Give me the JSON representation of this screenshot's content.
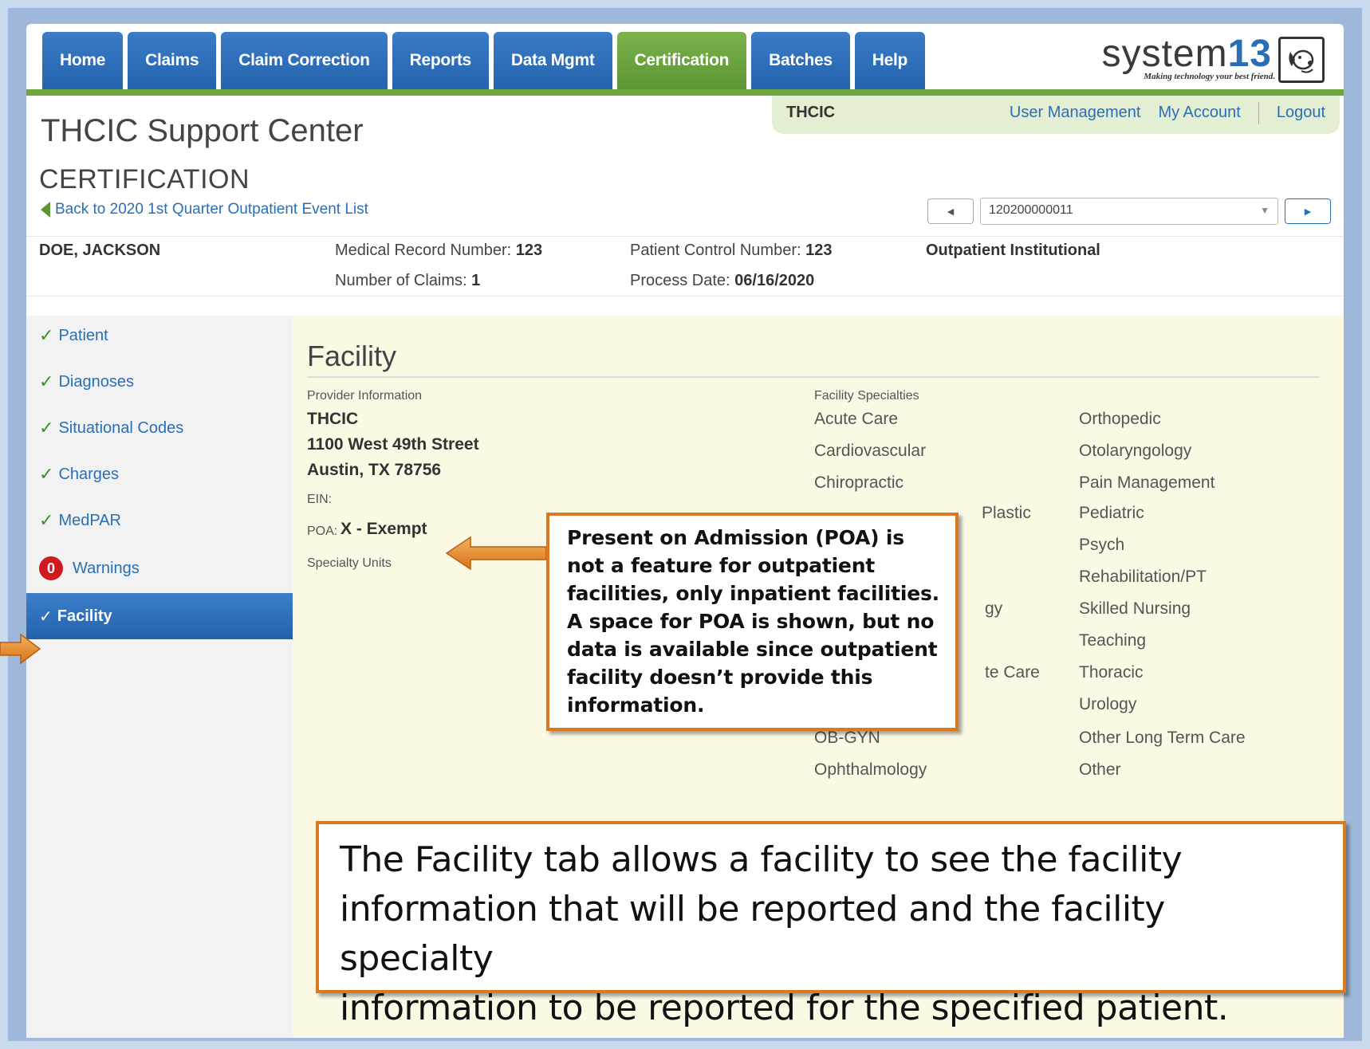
{
  "nav": {
    "tabs": [
      "Home",
      "Claims",
      "Claim Correction",
      "Reports",
      "Data Mgmt",
      "Certification",
      "Batches",
      "Help"
    ],
    "active_tab": "Certification"
  },
  "logo": {
    "name_a": "system",
    "name_b": "13",
    "tagline": "Making technology your best friend.",
    "icon": "dog-icon"
  },
  "userbar": {
    "org": "THCIC",
    "user_management": "User Management",
    "my_account": "My Account",
    "logout": "Logout"
  },
  "app_title": "THCIC Support Center",
  "section_title": "CERTIFICATION",
  "back_link": "Back to 2020 1st Quarter Outpatient Event List",
  "pager": {
    "selected": "120200000011",
    "prev_icon": "chevron-left-icon",
    "next_icon": "chevron-right-icon"
  },
  "patient": {
    "name": "DOE, JACKSON",
    "mrn_label": "Medical Record Number:",
    "mrn": "123",
    "claims_label": "Number of Claims:",
    "claims": "1",
    "pcn_label": "Patient Control Number:",
    "pcn": "123",
    "process_label": "Process Date:",
    "process_date": "06/16/2020",
    "type": "Outpatient Institutional"
  },
  "sidebar": {
    "items": [
      "Patient",
      "Diagnoses",
      "Situational Codes",
      "Charges",
      "MedPAR"
    ],
    "warnings_label": "Warnings",
    "warnings_count": "0",
    "active": "Facility"
  },
  "facility": {
    "title": "Facility",
    "provider_label": "Provider Information",
    "provider_name": "THCIC",
    "address1": "1100 West 49th Street",
    "address2": "Austin, TX 78756",
    "ein_label": "EIN:",
    "poa_label": "POA:",
    "poa_value": "X - Exempt",
    "specialty_units_label": "Specialty Units",
    "specialties_label": "Facility Specialties",
    "col1": [
      "Acute Care",
      "Cardiovascular",
      "Chiropractic",
      "Plastic",
      "gy",
      "te Care",
      "OB-GYN",
      "Ophthalmology"
    ],
    "col2": [
      "Orthopedic",
      "Otolaryngology",
      "Pain Management",
      "Pediatric",
      "Psych",
      "Rehabilitation/PT",
      "Skilled Nursing",
      "Teaching",
      "Thoracic",
      "Urology",
      "Other Long Term Care",
      "Other"
    ]
  },
  "callouts": {
    "poa_lines": [
      "Present on Admission (POA) is",
      "not a feature for outpatient",
      "facilities, only inpatient facilities.",
      "A space for POA is shown, but no",
      "data is available since outpatient",
      "facility doesn’t provide this",
      "information."
    ],
    "tab_lines": [
      "The Facility tab allows a facility to see the facility",
      "information that will be reported and the facility specialty",
      "information to be reported for the specified patient."
    ]
  },
  "colors": {
    "nav_blue": "#2a6fb4",
    "nav_green": "#5c9634",
    "callout_border": "#d97a1f",
    "main_bg": "#fbf8e4"
  }
}
